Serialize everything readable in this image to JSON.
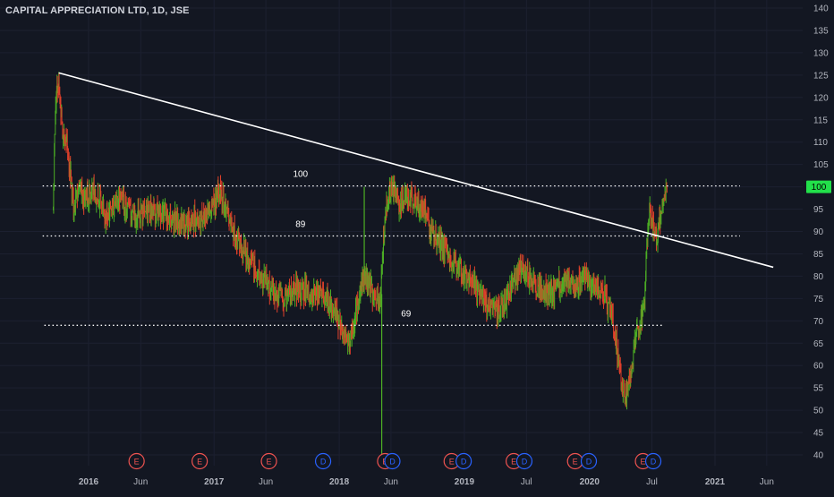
{
  "header": {
    "title": "CAPITAL APPRECIATION LTD, 1D, JSE"
  },
  "chart_data": {
    "type": "candlestick",
    "symbol": "CAPITAL APPRECIATION LTD",
    "interval": "1D",
    "exchange": "JSE",
    "current_price": "100",
    "y_axis": {
      "ticks": [
        40,
        45,
        50,
        55,
        60,
        65,
        70,
        75,
        80,
        85,
        90,
        95,
        100,
        105,
        110,
        115,
        120,
        125,
        130,
        135,
        140
      ],
      "ylim": [
        37,
        143
      ]
    },
    "x_axis": {
      "ticks": [
        {
          "label": "2016",
          "date": "2016-01-01",
          "major": true
        },
        {
          "label": "Jun",
          "date": "2016-06-01",
          "major": false
        },
        {
          "label": "2017",
          "date": "2017-01-01",
          "major": true
        },
        {
          "label": "Jun",
          "date": "2017-06-01",
          "major": false
        },
        {
          "label": "2018",
          "date": "2018-01-01",
          "major": true
        },
        {
          "label": "Jun",
          "date": "2018-06-01",
          "major": false
        },
        {
          "label": "2019",
          "date": "2019-01-01",
          "major": true
        },
        {
          "label": "Jul",
          "date": "2019-07-01",
          "major": false
        },
        {
          "label": "2020",
          "date": "2020-01-01",
          "major": true
        },
        {
          "label": "Jul",
          "date": "2020-07-01",
          "major": false
        },
        {
          "label": "2021",
          "date": "2021-01-01",
          "major": true
        },
        {
          "label": "Jun",
          "date": "2021-06-01",
          "major": false
        }
      ]
    },
    "price_path": [
      [
        "2015-09-20",
        95
      ],
      [
        "2015-09-26",
        118
      ],
      [
        "2015-10-01",
        122
      ],
      [
        "2015-10-06",
        124
      ],
      [
        "2015-10-18",
        112
      ],
      [
        "2015-10-28",
        110
      ],
      [
        "2015-11-10",
        102
      ],
      [
        "2015-11-20",
        93
      ],
      [
        "2015-12-01",
        100
      ],
      [
        "2015-12-20",
        97
      ],
      [
        "2016-01-20",
        99
      ],
      [
        "2016-02-20",
        94
      ],
      [
        "2016-04-01",
        97
      ],
      [
        "2016-05-15",
        93
      ],
      [
        "2016-07-01",
        95
      ],
      [
        "2016-09-01",
        93
      ],
      [
        "2016-10-15",
        92
      ],
      [
        "2016-12-01",
        93
      ],
      [
        "2017-01-01",
        96
      ],
      [
        "2017-01-20",
        99
      ],
      [
        "2017-02-10",
        95
      ],
      [
        "2017-03-05",
        88
      ],
      [
        "2017-04-10",
        84
      ],
      [
        "2017-05-15",
        80
      ],
      [
        "2017-06-15",
        77
      ],
      [
        "2017-07-15",
        75
      ],
      [
        "2017-09-01",
        77
      ],
      [
        "2017-10-15",
        76
      ],
      [
        "2017-11-20",
        75
      ],
      [
        "2017-12-15",
        73
      ],
      [
        "2018-01-10",
        68
      ],
      [
        "2018-01-30",
        65
      ],
      [
        "2018-02-15",
        70
      ],
      [
        "2018-03-01",
        76
      ],
      [
        "2018-03-20",
        80
      ],
      [
        "2018-04-10",
        76
      ],
      [
        "2018-05-01",
        75
      ],
      [
        "2018-05-10",
        88
      ],
      [
        "2018-05-20",
        96
      ],
      [
        "2018-06-05",
        100
      ],
      [
        "2018-06-25",
        96
      ],
      [
        "2018-07-25",
        98
      ],
      [
        "2018-08-20",
        96
      ],
      [
        "2018-09-10",
        93
      ],
      [
        "2018-10-01",
        89
      ],
      [
        "2018-10-20",
        88
      ],
      [
        "2018-11-20",
        84
      ],
      [
        "2018-12-15",
        82
      ],
      [
        "2019-01-15",
        79
      ],
      [
        "2019-02-15",
        77
      ],
      [
        "2019-03-15",
        73
      ],
      [
        "2019-04-10",
        72
      ],
      [
        "2019-05-10",
        76
      ],
      [
        "2019-06-10",
        81
      ],
      [
        "2019-07-10",
        80
      ],
      [
        "2019-08-10",
        77
      ],
      [
        "2019-09-10",
        76
      ],
      [
        "2019-10-20",
        79
      ],
      [
        "2019-11-20",
        78
      ],
      [
        "2019-12-15",
        80
      ],
      [
        "2020-01-15",
        78
      ],
      [
        "2020-02-15",
        76
      ],
      [
        "2020-03-10",
        70
      ],
      [
        "2020-03-25",
        62
      ],
      [
        "2020-04-05",
        55
      ],
      [
        "2020-04-15",
        53
      ],
      [
        "2020-04-30",
        58
      ],
      [
        "2020-05-15",
        66
      ],
      [
        "2020-05-30",
        70
      ],
      [
        "2020-06-10",
        75
      ],
      [
        "2020-06-18",
        90
      ],
      [
        "2020-06-25",
        96
      ],
      [
        "2020-07-05",
        91
      ],
      [
        "2020-07-15",
        89
      ],
      [
        "2020-07-25",
        93
      ],
      [
        "2020-08-05",
        97
      ],
      [
        "2020-08-15",
        99
      ]
    ],
    "spikes": [
      {
        "date": "2018-03-15",
        "high": 100,
        "low": 80
      },
      {
        "date": "2018-05-05",
        "high": 76,
        "low": 40
      }
    ],
    "trendline": {
      "start": [
        "2015-10-06",
        125.5
      ],
      "end": [
        "2021-06-20",
        82
      ]
    },
    "horizontal_levels": [
      {
        "label": "100",
        "value": 100.2,
        "from": "2015-08-20",
        "to": "2021-03-15"
      },
      {
        "label": "89",
        "value": 89.0,
        "from": "2015-08-20",
        "to": "2021-03-15"
      },
      {
        "label": "69",
        "value": 69.0,
        "from": "2015-08-25",
        "to": "2020-08-01"
      }
    ],
    "level_label_dates": [
      "2017-09-10",
      "2017-09-10",
      "2018-07-15"
    ],
    "events": [
      {
        "type": "E",
        "date": "2016-05-20"
      },
      {
        "type": "E",
        "date": "2016-11-20"
      },
      {
        "type": "E",
        "date": "2017-06-10"
      },
      {
        "type": "D",
        "date": "2017-11-15"
      },
      {
        "type": "E",
        "date": "2018-05-15"
      },
      {
        "type": "D",
        "date": "2018-06-05"
      },
      {
        "type": "E",
        "date": "2018-11-25"
      },
      {
        "type": "D",
        "date": "2018-12-30"
      },
      {
        "type": "E",
        "date": "2019-05-25"
      },
      {
        "type": "D",
        "date": "2019-06-25"
      },
      {
        "type": "E",
        "date": "2019-11-20"
      },
      {
        "type": "D",
        "date": "2019-12-30"
      },
      {
        "type": "E",
        "date": "2020-06-05"
      },
      {
        "type": "D",
        "date": "2020-07-05"
      }
    ],
    "colors": {
      "up": "#26a69a",
      "down": "#ef5350",
      "candle_up": "#4caf24",
      "candle_down": "#e0402a",
      "background": "#131722",
      "text": "#b2b5be",
      "price_label_bg": "#22e04a",
      "event_E": "#ef5350",
      "event_D": "#2962ff"
    }
  }
}
